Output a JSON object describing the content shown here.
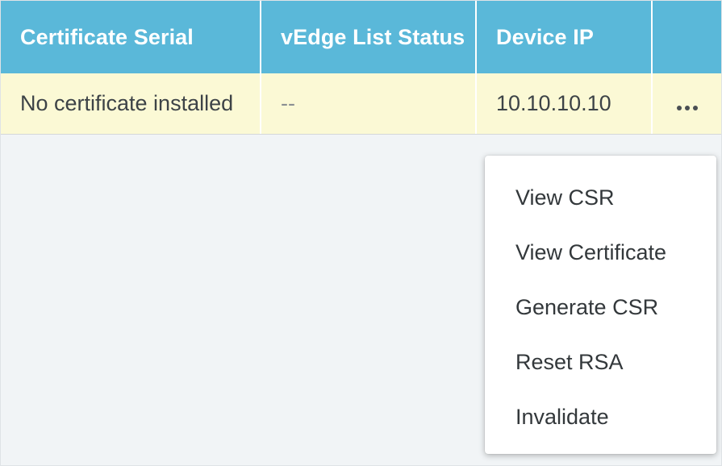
{
  "table": {
    "columns": [
      "Certificate Serial",
      "vEdge List Status",
      "Device IP",
      ""
    ],
    "rows": [
      {
        "certificate_serial": "No certificate installed",
        "vedge_list_status": "--",
        "device_ip": "10.10.10.10"
      }
    ]
  },
  "menu": {
    "items": [
      "View CSR",
      "View Certificate",
      "Generate CSR",
      "Reset RSA",
      "Invalidate"
    ]
  },
  "colors": {
    "header_bg": "#5ab8d9",
    "row_highlight": "#fbf9d5",
    "panel_bg": "#f1f4f6"
  },
  "icons": {
    "more_actions": "more-horizontal-icon"
  }
}
